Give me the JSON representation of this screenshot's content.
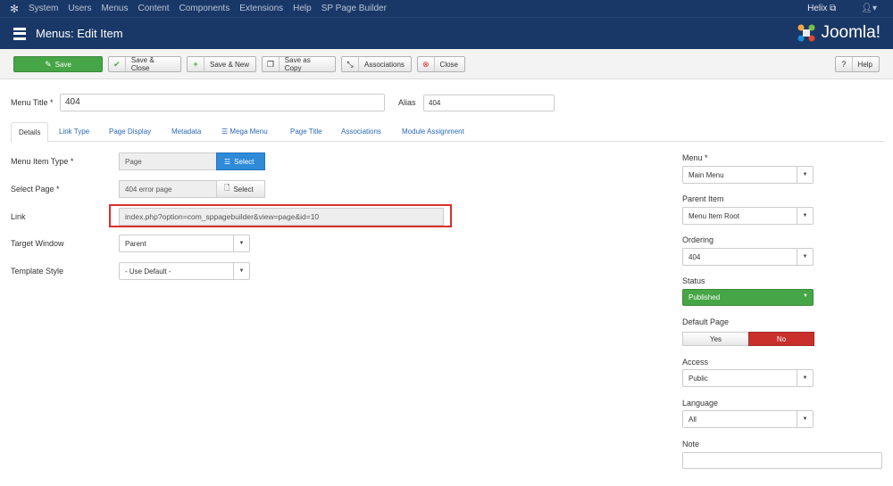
{
  "topnav": {
    "items": [
      "System",
      "Users",
      "Menus",
      "Content",
      "Components",
      "Extensions",
      "Help",
      "SP Page Builder"
    ],
    "site": "Helix"
  },
  "header": {
    "title": "Menus: Edit Item",
    "brand": "Joomla!"
  },
  "toolbar": {
    "save": "Save",
    "save_close": "Save & Close",
    "save_new": "Save & New",
    "save_copy": "Save as Copy",
    "associations": "Associations",
    "close": "Close",
    "help": "Help"
  },
  "form": {
    "menu_title_label": "Menu Title *",
    "menu_title_value": "404",
    "alias_label": "Alias",
    "alias_value": "404"
  },
  "tabs": [
    "Details",
    "Link Type",
    "Page Display",
    "Metadata",
    "Mega Menu",
    "Page Title",
    "Associations",
    "Module Assignment"
  ],
  "details": {
    "menu_item_type_label": "Menu Item Type *",
    "menu_item_type_value": "Page",
    "select_page_label": "Select Page *",
    "select_page_value": "404 error page",
    "select_label": "Select",
    "link_label": "Link",
    "link_value": "index.php?option=com_sppagebuilder&view=page&id=10",
    "target_window_label": "Target Window",
    "target_window_value": "Parent",
    "template_style_label": "Template Style",
    "template_style_value": "- Use Default -"
  },
  "sidebar": {
    "menu_label": "Menu *",
    "menu_value": "Main Menu",
    "parent_label": "Parent Item",
    "parent_value": "Menu Item Root",
    "ordering_label": "Ordering",
    "ordering_value": "404",
    "status_label": "Status",
    "status_value": "Published",
    "default_label": "Default Page",
    "yes": "Yes",
    "no": "No",
    "access_label": "Access",
    "access_value": "Public",
    "language_label": "Language",
    "language_value": "All",
    "note_label": "Note",
    "note_value": ""
  },
  "colors": {
    "navbar": "#1a3867",
    "save_green": "#46a546",
    "select_blue": "#2f8ad8",
    "no_red": "#c9302c",
    "highlight_red": "#d9302c",
    "link_blue": "#2a69b8"
  }
}
